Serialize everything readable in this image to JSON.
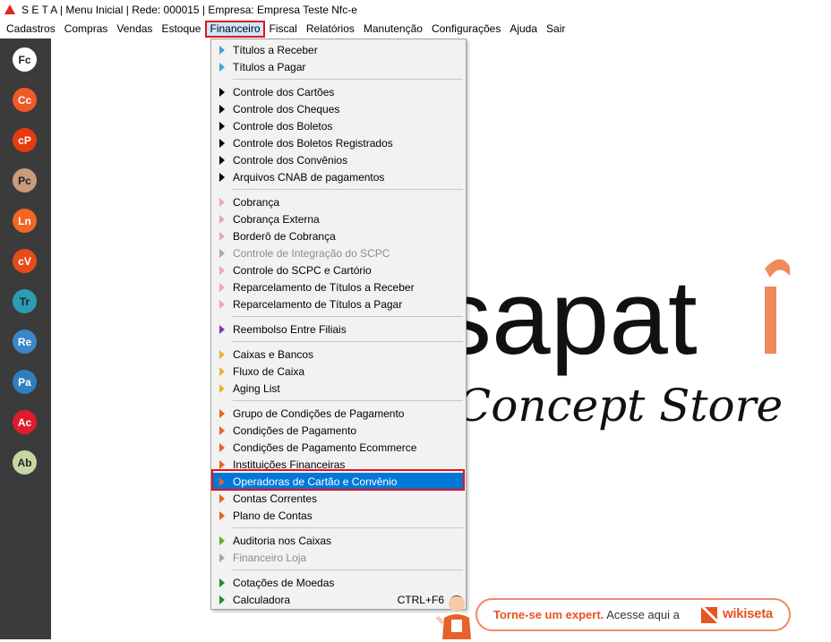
{
  "window": {
    "title": "S E T A | Menu Inicial | Rede: 000015 | Empresa: Empresa Teste Nfc-e"
  },
  "menubar": {
    "items": [
      {
        "label": "Cadastros"
      },
      {
        "label": "Compras"
      },
      {
        "label": "Vendas"
      },
      {
        "label": "Estoque"
      },
      {
        "label": "Financeiro",
        "active": true
      },
      {
        "label": "Fiscal"
      },
      {
        "label": "Relatórios"
      },
      {
        "label": "Manutenção"
      },
      {
        "label": "Configurações"
      },
      {
        "label": "Ajuda"
      },
      {
        "label": "Sair"
      }
    ]
  },
  "sidebar": {
    "buttons": [
      {
        "label": "Fc",
        "bg": "#ffffff",
        "fg": "#222222"
      },
      {
        "label": "Cc",
        "bg": "#f05a28",
        "fg": "#ffffff"
      },
      {
        "label": "cP",
        "bg": "#e83a10",
        "fg": "#ffffff"
      },
      {
        "label": "Pc",
        "bg": "#c99a7c",
        "fg": "#222222"
      },
      {
        "label": "Ln",
        "bg": "#f26522",
        "fg": "#ffffff"
      },
      {
        "label": "cV",
        "bg": "#e84a1a",
        "fg": "#ffffff"
      },
      {
        "label": "Tr",
        "bg": "#2a9db4",
        "fg": "#222222"
      },
      {
        "label": "Re",
        "bg": "#3a86c8",
        "fg": "#ffffff"
      },
      {
        "label": "Pa",
        "bg": "#2f7ec1",
        "fg": "#ffffff"
      },
      {
        "label": "Ac",
        "bg": "#e01c2a",
        "fg": "#ffffff"
      },
      {
        "label": "Ab",
        "bg": "#c7d6a4",
        "fg": "#222222"
      }
    ]
  },
  "dropdown": {
    "items": [
      {
        "label": "Títulos a Receber",
        "color": "#4a9fd8"
      },
      {
        "label": "Títulos a Pagar",
        "color": "#4a9fd8"
      },
      {
        "sep": true
      },
      {
        "label": "Controle dos Cartões",
        "color": "#000000"
      },
      {
        "label": "Controle dos Cheques",
        "color": "#000000"
      },
      {
        "label": "Controle dos Boletos",
        "color": "#000000"
      },
      {
        "label": "Controle dos Boletos Registrados",
        "color": "#000000"
      },
      {
        "label": "Controle dos Convênios",
        "color": "#000000"
      },
      {
        "label": "Arquivos CNAB de pagamentos",
        "color": "#000000"
      },
      {
        "sep": true
      },
      {
        "label": "Cobrança",
        "color": "#f0a0c8"
      },
      {
        "label": "Cobrança Externa",
        "color": "#f0a0c8"
      },
      {
        "label": "Borderô de Cobrança",
        "color": "#f0a0c8"
      },
      {
        "label": "Controle de Integração do SCPC",
        "color": "#a8a8a8",
        "disabled": true
      },
      {
        "label": "Controle do SCPC e Cartório",
        "color": "#f0a0c8"
      },
      {
        "label": "Reparcelamento de Títulos a Receber",
        "color": "#f0a0c8"
      },
      {
        "label": "Reparcelamento de Títulos a Pagar",
        "color": "#f0a0c8"
      },
      {
        "sep": true
      },
      {
        "label": "Reembolso Entre Filiais",
        "color": "#8a2fb8"
      },
      {
        "sep": true
      },
      {
        "label": "Caixas e Bancos",
        "color": "#f0b030"
      },
      {
        "label": "Fluxo de Caixa",
        "color": "#f0b030"
      },
      {
        "label": "Aging List",
        "color": "#f0b030"
      },
      {
        "sep": true
      },
      {
        "label": "Grupo de Condições de Pagamento",
        "color": "#e8602a"
      },
      {
        "label": "Condições de Pagamento",
        "color": "#e8602a"
      },
      {
        "label": "Condições de Pagamento Ecommerce",
        "color": "#e8602a"
      },
      {
        "label": "Instituições Financeiras",
        "color": "#e8602a"
      },
      {
        "label": "Operadoras de Cartão e Convênio",
        "color": "#e8602a",
        "highlight": true
      },
      {
        "label": "Contas Correntes",
        "color": "#e8602a"
      },
      {
        "label": "Plano de Contas",
        "color": "#e8602a"
      },
      {
        "sep": true
      },
      {
        "label": "Auditoria nos Caixas",
        "color": "#58b030"
      },
      {
        "label": "Financeiro Loja",
        "color": "#a8a8a8",
        "disabled": true
      },
      {
        "sep": true
      },
      {
        "label": "Cotações de Moedas",
        "color": "#1a8a3a"
      },
      {
        "label": "Calculadora",
        "color": "#1a8a3a",
        "shortcut": "CTRL+F6"
      }
    ]
  },
  "brand": {
    "word": "sapat",
    "tagline": "Concept Store"
  },
  "banner": {
    "text_bold": "Torne-se um expert.",
    "text_rest": " Acesse aqui a",
    "wiki": "wikiseta"
  }
}
